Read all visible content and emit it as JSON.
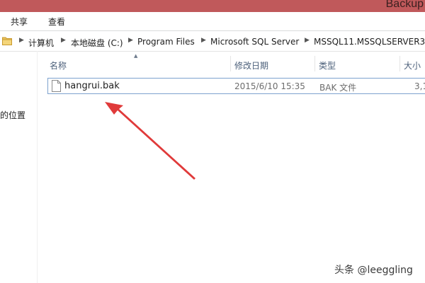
{
  "window": {
    "title": "Backup"
  },
  "ribbon": {
    "tabs": [
      {
        "label": "共享"
      },
      {
        "label": "查看"
      }
    ]
  },
  "address_bar": {
    "icon": "folder-icon",
    "separator_icon": "chevron-right-icon",
    "crumbs": [
      {
        "label": "计算机"
      },
      {
        "label": "本地磁盘 (C:)"
      },
      {
        "label": "Program Files"
      },
      {
        "label": "Microsoft SQL Server"
      },
      {
        "label": "MSSQL11.MSSQLSERVER3"
      }
    ]
  },
  "navigation_pane": {
    "visible_fragment": "的位置"
  },
  "file_list": {
    "columns": [
      {
        "label": "名称"
      },
      {
        "label": "修改日期"
      },
      {
        "label": "类型"
      },
      {
        "label": "大小"
      }
    ],
    "sort_indicator": "sort-ascending-icon",
    "rows": [
      {
        "name": "hangrui.bak",
        "modified": "2015/6/10 15:35",
        "type": "BAK 文件",
        "size": "3,1",
        "icon": "file-icon"
      }
    ]
  },
  "annotation": {
    "arrow_color": "#e03a3a",
    "icon": "red-arrow-annotation"
  },
  "watermark": {
    "text": "头条 @leeggling"
  },
  "colors": {
    "titlebar": "#c0595b",
    "selection_border": "#7da2ce",
    "header_text": "#4c607a"
  }
}
